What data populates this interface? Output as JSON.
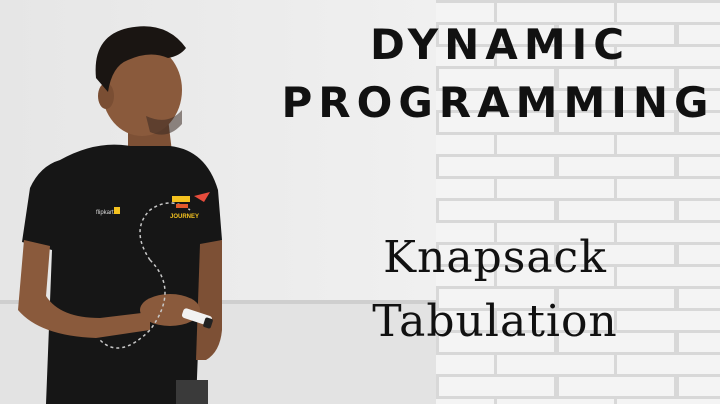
{
  "thumbnail": {
    "title_line1": "DYNAMIC",
    "title_line2": "PROGRAMMING",
    "subtitle_line1": "Knapsack",
    "subtitle_line2": "Tabulation",
    "shirt_brand": "flipkart",
    "shirt_graphic_text": "JOURNEY"
  },
  "colors": {
    "wall_left": "#ececec",
    "brick_wall": "#f3f3f3",
    "brick_mortar": "#d6d6d6",
    "shirt": "#161616",
    "skin": "#8a5a3c",
    "hair": "#1a1512",
    "text": "#111111"
  },
  "icons": [
    "marker-pen-icon",
    "brand-logo-icon"
  ]
}
